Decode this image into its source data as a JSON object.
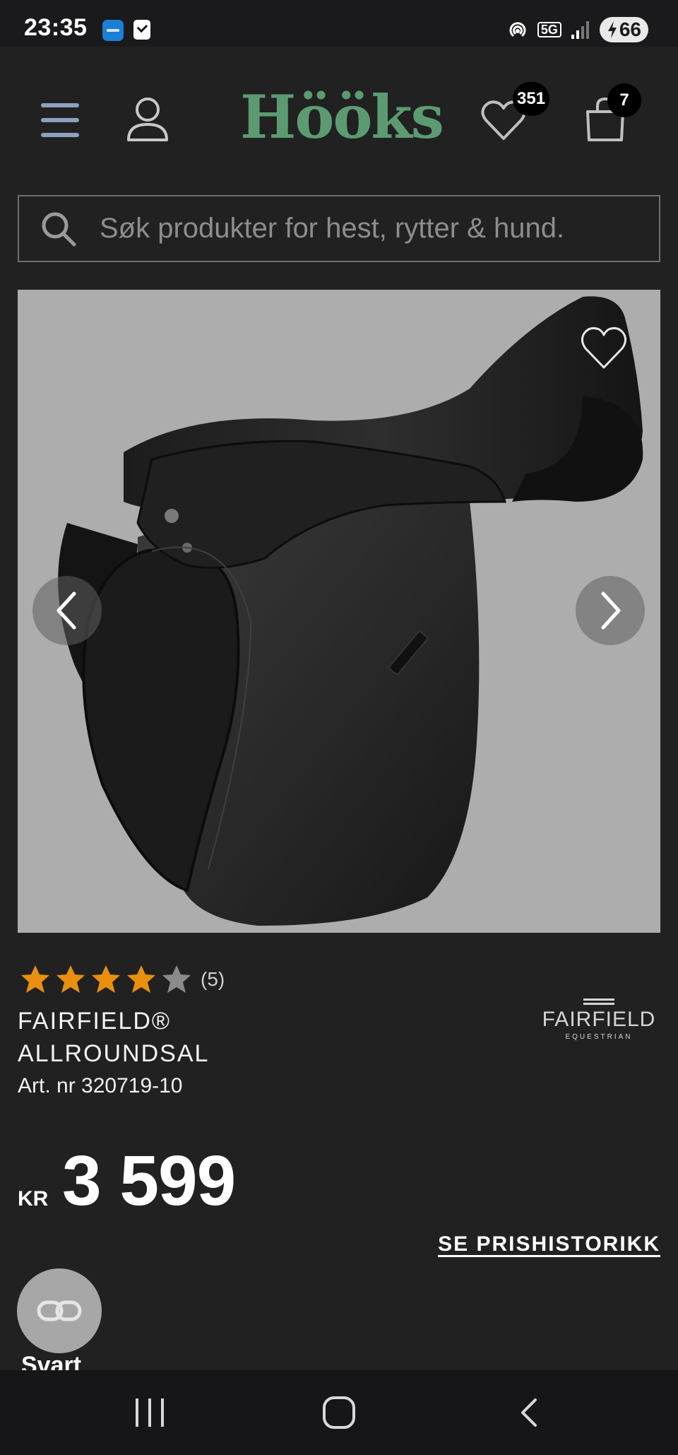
{
  "status_bar": {
    "time": "23:35",
    "network": "5G",
    "battery": "66"
  },
  "header": {
    "brand": "Hööks",
    "wishlist_count": "351",
    "cart_count": "7"
  },
  "search": {
    "placeholder": "Søk produkter for hest, rytter & hund."
  },
  "product": {
    "rating_value": 4,
    "rating_max": 5,
    "rating_count": "(5)",
    "title": "FAIRFIELD® ALLROUNDSAL",
    "art_nr": "Art. nr 320719-10",
    "brand_logo": {
      "name": "FAIRFIELD",
      "subtitle": "EQUESTRIAN"
    },
    "price_currency": "KR",
    "price_value": "3 599",
    "price_history_link": "SE PRISHISTORIKK",
    "color_label": "Svart"
  },
  "colors": {
    "star_active": "#e8900e",
    "star_inactive": "#8a8a8a",
    "brand_green": "#5c9b72",
    "background": "#212121"
  },
  "icons": {
    "menu": "hamburger-icon",
    "account": "user-icon",
    "wishlist": "heart-icon",
    "cart": "shopping-bag-icon",
    "search": "search-icon",
    "prev": "chevron-left-icon",
    "next": "chevron-right-icon",
    "swatch": "link-icon"
  }
}
